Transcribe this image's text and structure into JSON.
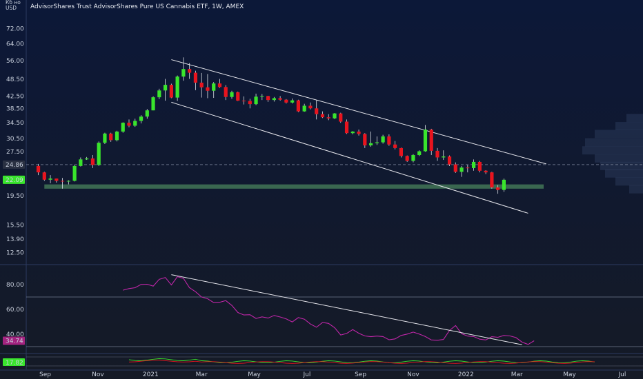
{
  "header": {
    "title": "AdvisorShares Trust AdvisorShares Pure US Cannabis ETF, 1W, AMEX",
    "currency_line1": "Кб но",
    "currency_line2": "USD"
  },
  "colors": {
    "background_top": "#0c1838",
    "background_bottom": "#151a26",
    "up": "#39e52c",
    "down": "#e8141e",
    "rsi": "#c026a8",
    "support_zone": "#3d6b52",
    "channel": "#e8e8ee",
    "price_badge_current": "#39e52c",
    "price_badge_last": "#2a3142",
    "rsi_badge": "#a3237f",
    "osc_badge": "#39e52c"
  },
  "chart_data": [
    {
      "type": "candlestick",
      "title": "AdvisorShares Trust AdvisorShares Pure US Cannabis ETF, 1W, AMEX",
      "y_scale": "log",
      "ylim": [
        11.5,
        80
      ],
      "y_ticks": [
        "72.00",
        "64.00",
        "56.00",
        "48.50",
        "42.50",
        "38.50",
        "34.50",
        "30.50",
        "27.50",
        "24.86",
        "22.09",
        "19.50",
        "15.50",
        "13.90",
        "12.50"
      ],
      "x_ticks": [
        "Sep",
        "Nov",
        "2021",
        "Mar",
        "May",
        "Jul",
        "Sep",
        "Nov",
        "2022",
        "Mar",
        "May",
        "Jul"
      ],
      "x_range": [
        "2020-08-10",
        "2022-07-25"
      ],
      "tick_dates": [
        "2020-09-01",
        "2020-11-01",
        "2021-01-01",
        "2021-03-01",
        "2021-05-01",
        "2021-07-01",
        "2021-09-01",
        "2021-11-01",
        "2022-01-01",
        "2022-03-01",
        "2022-05-01",
        "2022-07-01"
      ],
      "start_date": "2020-08-24",
      "week_step_days": 7,
      "ohlc": [
        [
          24.6,
          25.0,
          22.9,
          23.4
        ],
        [
          23.4,
          23.5,
          21.9,
          22.1
        ],
        [
          22.1,
          22.9,
          21.5,
          22.3
        ],
        [
          22.3,
          22.3,
          21.6,
          21.9
        ],
        [
          21.9,
          22.4,
          20.6,
          21.8
        ],
        [
          21.8,
          22.0,
          21.3,
          21.9
        ],
        [
          21.9,
          24.8,
          21.8,
          24.6
        ],
        [
          24.6,
          26.3,
          24.5,
          25.9
        ],
        [
          25.9,
          26.4,
          25.8,
          26.1
        ],
        [
          26.1,
          26.8,
          24.2,
          24.8
        ],
        [
          24.8,
          29.8,
          24.6,
          29.5
        ],
        [
          29.5,
          31.9,
          29.2,
          31.7
        ],
        [
          31.7,
          31.9,
          29.7,
          30.1
        ],
        [
          30.1,
          32.4,
          29.8,
          32.2
        ],
        [
          32.2,
          34.6,
          31.9,
          34.5
        ],
        [
          34.5,
          35.4,
          33.3,
          33.7
        ],
        [
          33.7,
          35.6,
          33.4,
          35.0
        ],
        [
          35.0,
          36.6,
          34.3,
          36.2
        ],
        [
          36.2,
          38.4,
          35.6,
          38.0
        ],
        [
          38.0,
          42.4,
          38.0,
          42.1
        ],
        [
          42.1,
          45.0,
          41.5,
          44.4
        ],
        [
          44.4,
          48.6,
          41.0,
          46.4
        ],
        [
          46.4,
          46.8,
          41.8,
          42.0
        ],
        [
          42.0,
          49.9,
          40.9,
          49.5
        ],
        [
          49.5,
          57.5,
          47.9,
          52.5
        ],
        [
          52.5,
          55.0,
          48.6,
          51.0
        ],
        [
          51.0,
          51.8,
          44.5,
          47.2
        ],
        [
          47.2,
          50.9,
          42.0,
          45.5
        ],
        [
          45.5,
          50.5,
          41.8,
          44.3
        ],
        [
          44.3,
          47.4,
          41.9,
          46.9
        ],
        [
          46.9,
          48.6,
          45.3,
          45.6
        ],
        [
          45.6,
          46.3,
          41.2,
          42.2
        ],
        [
          42.2,
          44.3,
          41.6,
          43.8
        ],
        [
          43.8,
          44.0,
          40.9,
          41.0
        ],
        [
          41.0,
          42.4,
          39.8,
          40.9
        ],
        [
          40.9,
          41.6,
          38.6,
          39.9
        ],
        [
          39.9,
          43.3,
          39.6,
          42.3
        ],
        [
          42.3,
          43.2,
          41.2,
          42.5
        ],
        [
          42.5,
          42.6,
          40.6,
          41.2
        ],
        [
          41.2,
          42.2,
          40.7,
          41.8
        ],
        [
          41.8,
          42.5,
          41.0,
          41.3
        ],
        [
          41.3,
          41.5,
          40.1,
          40.4
        ],
        [
          40.4,
          41.7,
          40.1,
          41.1
        ],
        [
          41.1,
          41.3,
          37.5,
          37.7
        ],
        [
          37.7,
          40.0,
          37.6,
          39.4
        ],
        [
          39.4,
          40.4,
          38.3,
          38.6
        ],
        [
          38.6,
          41.1,
          35.4,
          36.9
        ],
        [
          36.9,
          37.7,
          35.8,
          36.0
        ],
        [
          36.0,
          36.9,
          35.2,
          35.7
        ],
        [
          35.7,
          37.2,
          35.5,
          37.1
        ],
        [
          37.1,
          37.3,
          34.5,
          34.8
        ],
        [
          34.8,
          35.4,
          31.6,
          31.8
        ],
        [
          31.8,
          32.3,
          31.5,
          32.2
        ],
        [
          32.2,
          32.7,
          31.2,
          31.6
        ],
        [
          31.6,
          31.8,
          28.3,
          28.9
        ],
        [
          28.9,
          32.2,
          28.6,
          29.4
        ],
        [
          29.4,
          31.0,
          29.0,
          29.6
        ],
        [
          29.6,
          31.4,
          29.3,
          31.0
        ],
        [
          31.0,
          31.5,
          28.8,
          29.1
        ],
        [
          29.1,
          29.9,
          28.0,
          28.3
        ],
        [
          28.3,
          28.4,
          26.3,
          26.6
        ],
        [
          26.6,
          26.7,
          25.4,
          25.6
        ],
        [
          25.6,
          27.0,
          25.3,
          26.8
        ],
        [
          26.8,
          27.8,
          26.6,
          27.6
        ],
        [
          27.6,
          33.9,
          27.5,
          32.7
        ],
        [
          32.7,
          32.9,
          26.8,
          27.7
        ],
        [
          27.7,
          28.3,
          25.6,
          26.3
        ],
        [
          26.3,
          27.8,
          25.8,
          26.5
        ],
        [
          26.5,
          26.7,
          24.6,
          24.9
        ],
        [
          24.9,
          25.3,
          23.3,
          23.5
        ],
        [
          23.5,
          24.6,
          22.6,
          24.3
        ],
        [
          24.3,
          24.8,
          23.4,
          24.2
        ],
        [
          24.2,
          25.9,
          23.7,
          25.4
        ],
        [
          25.4,
          25.6,
          23.4,
          23.7
        ],
        [
          23.7,
          23.8,
          23.1,
          23.4
        ],
        [
          23.4,
          23.5,
          20.6,
          20.8
        ],
        [
          20.8,
          21.2,
          19.8,
          20.4
        ],
        [
          20.4,
          22.3,
          20.1,
          22.09
        ]
      ],
      "current_price": "22.09",
      "last_price_line": "24.86",
      "support_zone": [
        20.6,
        21.3
      ],
      "channel_upper": [
        [
          "2021-01-25",
          56.5
        ],
        [
          "2022-04-04",
          25.0
        ]
      ],
      "channel_lower": [
        [
          "2021-01-25",
          40.5
        ],
        [
          "2022-03-14",
          17.0
        ]
      ],
      "volume_profile_levels": [
        20.5,
        21.8,
        23.2,
        24.6,
        26.1,
        27.8,
        29.6,
        31.6,
        33.6,
        35.8
      ]
    },
    {
      "type": "line",
      "name": "RSI",
      "ylim": [
        25,
        95
      ],
      "y_ticks": [
        "80.00",
        "60.00",
        "40.00"
      ],
      "levels": [
        70,
        30
      ],
      "current_value": "34.74",
      "start_date": "2020-11-30",
      "values": [
        75.5,
        76.8,
        77.5,
        80.1,
        80.3,
        78.8,
        84.3,
        85.7,
        79.7,
        86.4,
        85.0,
        77.5,
        74.3,
        70.0,
        68.6,
        65.5,
        65.8,
        67.1,
        63.2,
        57.5,
        55.5,
        55.7,
        52.7,
        54.0,
        53.0,
        55.1,
        53.9,
        52.4,
        49.9,
        53.4,
        52.1,
        48.2,
        45.6,
        49.5,
        48.7,
        45.3,
        39.4,
        40.6,
        43.7,
        40.8,
        38.6,
        38.0,
        38.5,
        38.1,
        35.5,
        36.2,
        39.0,
        40.1,
        41.7,
        40.1,
        38.1,
        35.4,
        35.1,
        35.8,
        43.0,
        47.0,
        40.4,
        38.5,
        38.1,
        36.0,
        35.4,
        38.0,
        37.5,
        39.0,
        38.6,
        37.3,
        33.6,
        31.8,
        34.74
      ],
      "trendline": [
        [
          "2021-01-25",
          88.0
        ],
        [
          "2022-03-07",
          31.5
        ]
      ]
    },
    {
      "type": "line",
      "name": "Oscillator",
      "current_value": "17.82"
    }
  ]
}
